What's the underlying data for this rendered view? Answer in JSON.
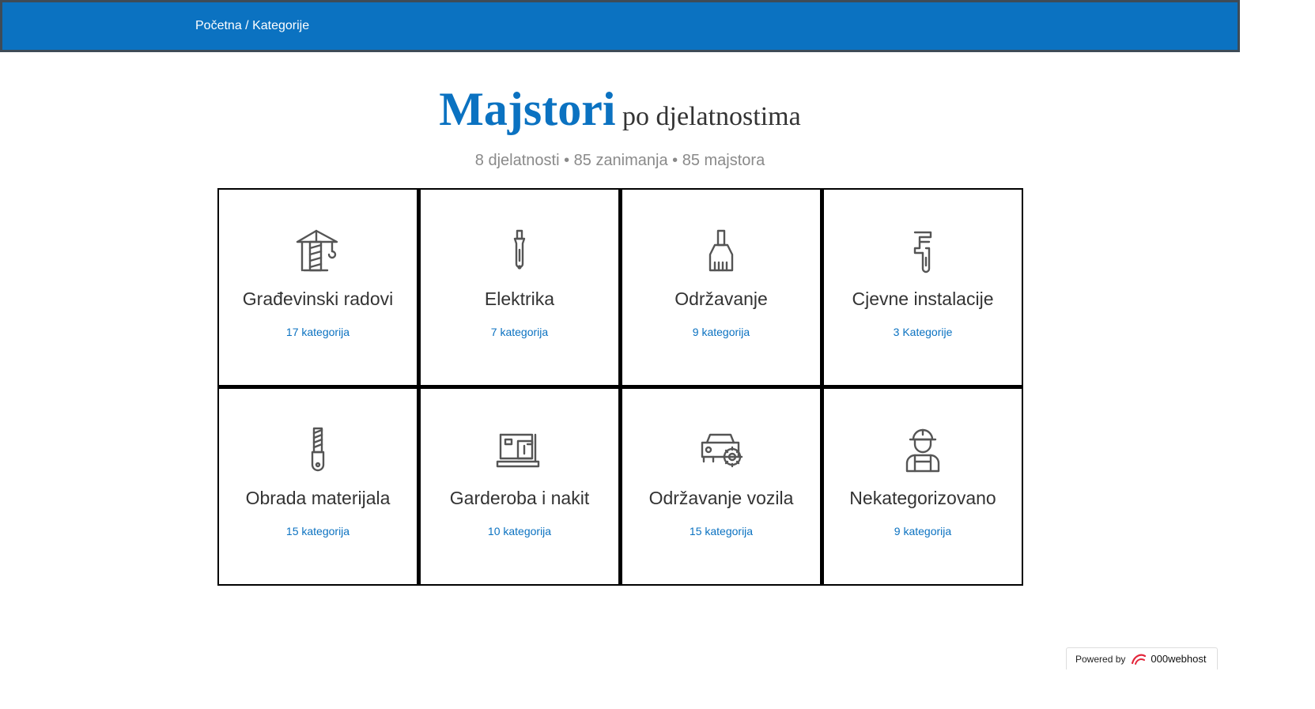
{
  "breadcrumb": {
    "home": "Početna",
    "separator": "/",
    "current": "Kategorije"
  },
  "heading": {
    "main": "Majstori",
    "rest": "po djelatnostima"
  },
  "subtitle": "8 djelatnosti • 85 zanimanja • 85 majstora",
  "colors": {
    "accent": "#0b72c1",
    "text": "#333333",
    "muted": "#8a8a8a",
    "grid": "#000000"
  },
  "categories": [
    {
      "title": "Građevinski radovi",
      "count": "17 kategorija",
      "icon": "crane-icon"
    },
    {
      "title": "Elektrika",
      "count": "7 kategorija",
      "icon": "screwdriver-icon"
    },
    {
      "title": "Održavanje",
      "count": "9 kategorija",
      "icon": "brush-icon"
    },
    {
      "title": "Cjevne instalacije",
      "count": "3 Kategorije",
      "icon": "pipe-wrench-icon"
    },
    {
      "title": "Obrada materijala",
      "count": "15 kategorija",
      "icon": "file-tool-icon"
    },
    {
      "title": "Garderoba i nakit",
      "count": "10 kategorija",
      "icon": "sewing-machine-icon"
    },
    {
      "title": "Održavanje vozila",
      "count": "15 kategorija",
      "icon": "car-gear-icon"
    },
    {
      "title": "Nekategorizovano",
      "count": "9 kategorija",
      "icon": "worker-icon"
    }
  ],
  "powered": {
    "label": "Powered by",
    "brand": "000webhost"
  }
}
